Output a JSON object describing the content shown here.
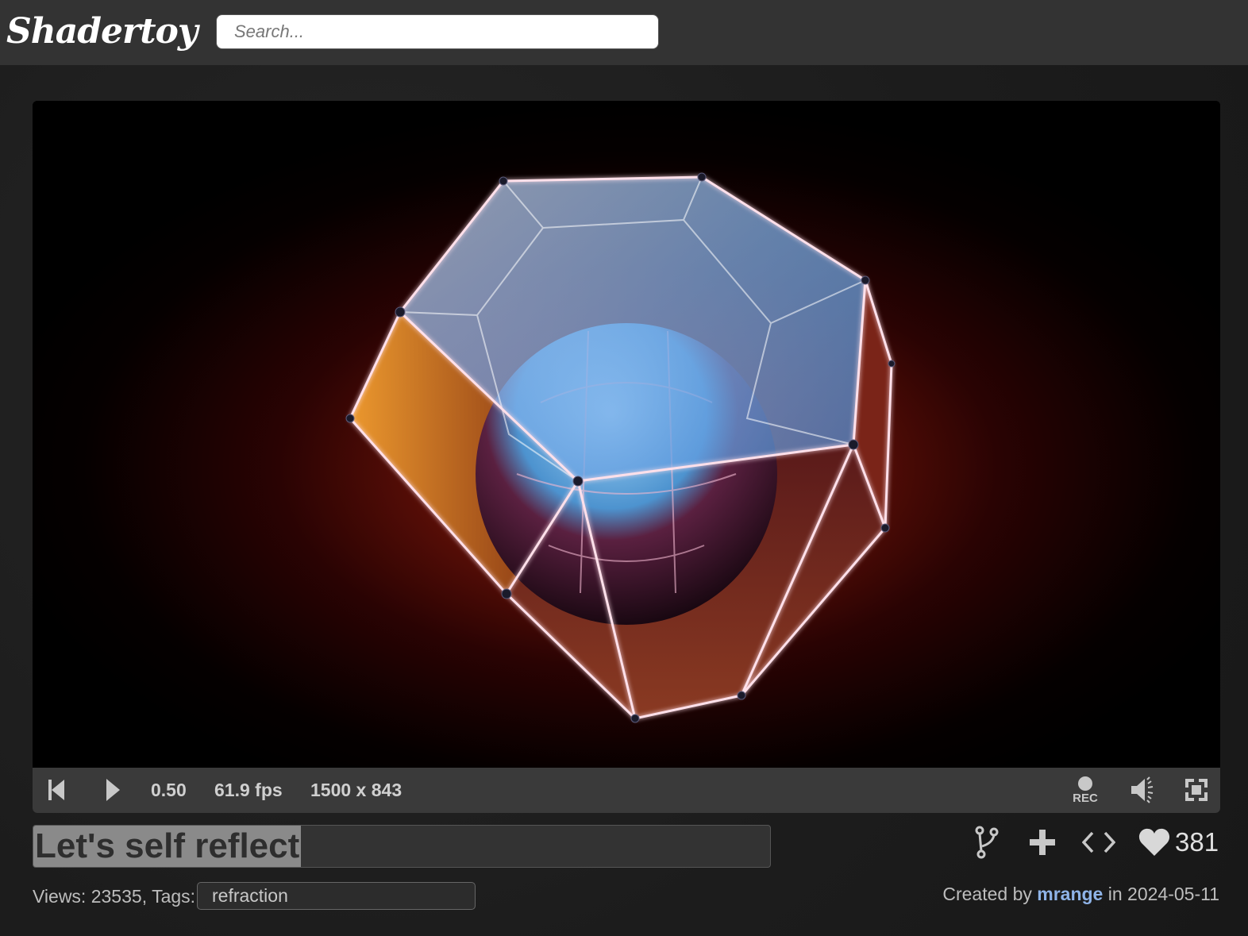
{
  "header": {
    "logo": "Shadertoy",
    "search_placeholder": "Search..."
  },
  "player": {
    "time": "0.50",
    "fps": "61.9 fps",
    "resolution": "1500 x 843",
    "rec_label": "REC",
    "icons": [
      "rewind-icon",
      "play-icon",
      "record-icon",
      "volume-icon",
      "fullscreen-icon"
    ]
  },
  "shader": {
    "title": "Let's self reflect",
    "likes": "381",
    "views_label": "Views:",
    "views": "23535",
    "tags_label": "Tags:",
    "tags": "refraction",
    "created_prefix": "Created by",
    "author": "mrange",
    "created_in": "in",
    "date": "2024-05-11",
    "actions": [
      "fork-icon",
      "add-playlist-icon",
      "embed-code-icon",
      "heart-icon"
    ]
  },
  "colors": {
    "topbar": "#333333",
    "accent_link": "#8fb4e8",
    "controls_bar": "#3a3a3a"
  }
}
